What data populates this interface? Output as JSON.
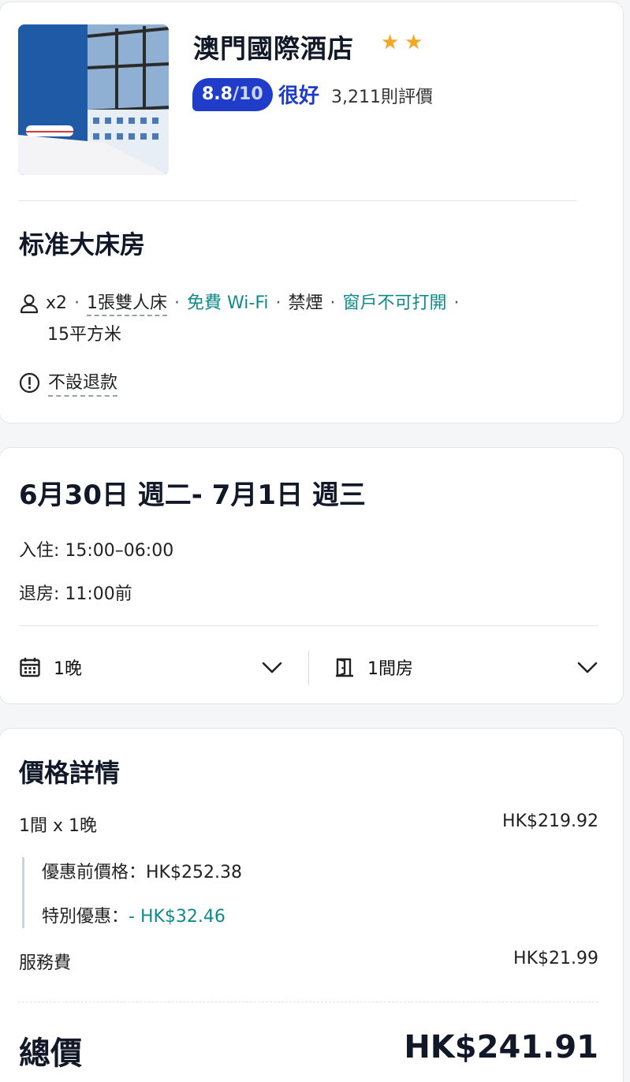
{
  "hotel": {
    "name": "澳門國際酒店",
    "stars": 2,
    "score": "8.8",
    "score_out_of": "/10",
    "rating_word": "很好",
    "review_count": "3,211則評價"
  },
  "room": {
    "name": "标准大床房",
    "guests": "x2",
    "bed": "1張雙人床",
    "wifi": "免費 Wi-Fi",
    "smoking": "禁煙",
    "window": "窗戶不可打開",
    "size": "15平方米",
    "refund": "不設退款"
  },
  "stay": {
    "date_range": "6月30日 週二- 7月1日 週三",
    "checkin": "入住: 15:00–06:00",
    "checkout": "退房: 11:00前",
    "nights": "1晚",
    "rooms": "1間房"
  },
  "price": {
    "title": "價格詳情",
    "line1_label": "1間 x 1晚",
    "line1_value": "HK$219.92",
    "original_label": "優惠前價格：",
    "original_value": "HK$252.38",
    "discount_label": "特別優惠：",
    "discount_value": "- HK$32.46",
    "service_label": "服務費",
    "service_value": "HK$21.99",
    "total_label": "總價",
    "total_value": "HK$241.91"
  },
  "colors": {
    "accent_blue": "#1f3dc9",
    "teal": "#0f8a8a",
    "star": "#f5a623"
  },
  "icons": [
    "person-icon",
    "info-icon",
    "calendar-icon",
    "door-icon",
    "chevron-down-icon",
    "star-icon"
  ]
}
